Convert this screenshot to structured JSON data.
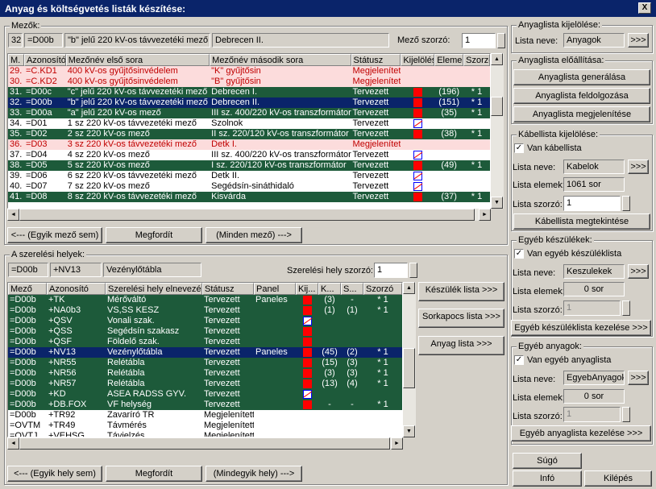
{
  "window": {
    "title": "Anyag és költségvetés listák készítése:",
    "close": "X"
  },
  "fields": {
    "label": "Mezők:",
    "num": "32",
    "code": "=D00b",
    "name1": "\"b\" jelű 220 kV-os távvezetéki mező",
    "name2": "Debrecen II.",
    "multiplier_label": "Mező szorzó:",
    "multiplier": "1",
    "headers": [
      "M.",
      "Azonosító",
      "Mezőnév első sora",
      "Mezőnév második sora",
      "Státusz",
      "Kijelölés",
      "Elemek",
      "Szorzó"
    ],
    "rows": [
      {
        "s": "pink",
        "m": "29.",
        "id": "=C.KD1",
        "n1": "400 kV-os gyűjtősinvédelem",
        "n2": "\"K\" gyűjtősin",
        "st": "Megjelenített",
        "k": "",
        "e": "",
        "sz": ""
      },
      {
        "s": "pink",
        "m": "30.",
        "id": "=C.KD2",
        "n1": "400 kV-os gyűjtősinvédelem",
        "n2": "\"B\" gyűjtősin",
        "st": "Megjelenített",
        "k": "",
        "e": "",
        "sz": ""
      },
      {
        "s": "green",
        "m": "31.",
        "id": "=D00c",
        "n1": "\"c\" jelű 220 kV-os távvezetéki mező",
        "n2": "Debrecen I.",
        "st": "Tervezett",
        "k": "red",
        "e": "(196)",
        "sz": "* 1"
      },
      {
        "s": "sel",
        "m": "32.",
        "id": "=D00b",
        "n1": "\"b\" jelű 220 kV-os távvezetéki mező",
        "n2": "Debrecen II.",
        "st": "Tervezett",
        "k": "red",
        "e": "(151)",
        "sz": "* 1"
      },
      {
        "s": "green",
        "m": "33.",
        "id": "=D00a",
        "n1": "\"a\" jelű 220 kV-os mező",
        "n2": "III sz. 400/220 kV-os transzformátor",
        "st": "Tervezett",
        "k": "red",
        "e": "(35)",
        "sz": "* 1"
      },
      {
        "s": "wh",
        "m": "34.",
        "id": "=D01",
        "n1": "1 sz 220 kV-os távvezetéki mező",
        "n2": "Szolnok",
        "st": "Tervezett",
        "k": "x",
        "e": "",
        "sz": ""
      },
      {
        "s": "green",
        "m": "35.",
        "id": "=D02",
        "n1": "2 sz 220 kV-os mező",
        "n2": "II sz. 220/120 kV-os transzformátor",
        "st": "Tervezett",
        "k": "red",
        "e": "(38)",
        "sz": "* 1"
      },
      {
        "s": "pink",
        "m": "36.",
        "id": "=D03",
        "n1": "3 sz 220 kV-os távvezetéki mező",
        "n2": "Detk I.",
        "st": "Megjelenített",
        "k": "",
        "e": "",
        "sz": ""
      },
      {
        "s": "wh",
        "m": "37.",
        "id": "=D04",
        "n1": "4 sz 220 kV-os mező",
        "n2": "III sz. 400/220 kV-os transzformátor",
        "st": "Tervezett",
        "k": "x",
        "e": "",
        "sz": ""
      },
      {
        "s": "green",
        "m": "38.",
        "id": "=D05",
        "n1": "5 sz 220 kV-os mező",
        "n2": "I sz. 220/120 kV-os transzformátor",
        "st": "Tervezett",
        "k": "red",
        "e": "(49)",
        "sz": "* 1"
      },
      {
        "s": "wh",
        "m": "39.",
        "id": "=D06",
        "n1": "6 sz 220 kV-os távvezetéki mező",
        "n2": "Detk II.",
        "st": "Tervezett",
        "k": "x",
        "e": "",
        "sz": ""
      },
      {
        "s": "wh",
        "m": "40.",
        "id": "=D07",
        "n1": "7 sz 220 kV-os mező",
        "n2": "Segédsín-sináthidaló",
        "st": "Tervezett",
        "k": "x",
        "e": "",
        "sz": ""
      },
      {
        "s": "green",
        "m": "41.",
        "id": "=D08",
        "n1": "8 sz 220 kV-os távvezetéki mező",
        "n2": "Kisvárda",
        "st": "Tervezett",
        "k": "red",
        "e": "(37)",
        "sz": "* 1"
      }
    ],
    "btn_none": "<--- (Egyik mező sem)",
    "btn_reverse": "Megfordít",
    "btn_all": "(Minden mező) --->"
  },
  "places": {
    "label": "A szerelési helyek:",
    "code": "=D00b",
    "loc": "+NV13",
    "name": "Vezénylőtábla",
    "multiplier_label": "Szerelési hely szorzó:",
    "multiplier": "1",
    "headers": [
      "Mező",
      "Azonosító",
      "Szerelési hely elnevezés",
      "Státusz",
      "Panel",
      "Kij...",
      "K...",
      "S...",
      "Szorzó"
    ],
    "rows": [
      {
        "s": "green",
        "m": "=D00b",
        "id": "+TK",
        "n": "Mérőváltó",
        "st": "Tervezett",
        "p": "Paneles",
        "k": "red",
        "a": "(3)",
        "b": "-",
        "sz": "* 1"
      },
      {
        "s": "green",
        "m": "=D00b",
        "id": "+NA0b3",
        "n": "VS,SS KESZ",
        "st": "Tervezett",
        "p": "",
        "k": "red",
        "a": "(1)",
        "b": "(1)",
        "sz": "* 1"
      },
      {
        "s": "green",
        "m": "=D00b",
        "id": "+QSV",
        "n": "Vonali szak.",
        "st": "Tervezett",
        "p": "",
        "k": "x",
        "a": "",
        "b": "",
        "sz": ""
      },
      {
        "s": "green",
        "m": "=D00b",
        "id": "+QSS",
        "n": "Segédsín szakasz",
        "st": "Tervezett",
        "p": "",
        "k": "red",
        "a": "",
        "b": "",
        "sz": ""
      },
      {
        "s": "green",
        "m": "=D00b",
        "id": "+QSF",
        "n": "Földelő szak.",
        "st": "Tervezett",
        "p": "",
        "k": "red",
        "a": "",
        "b": "",
        "sz": ""
      },
      {
        "s": "sel",
        "m": "=D00b",
        "id": "+NV13",
        "n": "Vezénylőtábla",
        "st": "Tervezett",
        "p": "Paneles",
        "k": "red",
        "a": "(45)",
        "b": "(2)",
        "sz": "* 1"
      },
      {
        "s": "green",
        "m": "=D00b",
        "id": "+NR55",
        "n": "Relétábla",
        "st": "Tervezett",
        "p": "",
        "k": "red",
        "a": "(15)",
        "b": "(3)",
        "sz": "* 1"
      },
      {
        "s": "green",
        "m": "=D00b",
        "id": "+NR56",
        "n": "Relétábla",
        "st": "Tervezett",
        "p": "",
        "k": "red",
        "a": "(3)",
        "b": "(3)",
        "sz": "* 1"
      },
      {
        "s": "green",
        "m": "=D00b",
        "id": "+NR57",
        "n": "Relétábla",
        "st": "Tervezett",
        "p": "",
        "k": "red",
        "a": "(13)",
        "b": "(4)",
        "sz": "* 1"
      },
      {
        "s": "green",
        "m": "=D00b",
        "id": "+KD",
        "n": "ASEA RADSS GYV.",
        "st": "Tervezett",
        "p": "",
        "k": "x",
        "a": "",
        "b": "",
        "sz": ""
      },
      {
        "s": "green",
        "m": "=D00b",
        "id": "+DB.FOX",
        "n": "VF helység",
        "st": "Tervezett",
        "p": "",
        "k": "red",
        "a": "-",
        "b": "-",
        "sz": "* 1"
      },
      {
        "s": "wh",
        "m": "=D00b",
        "id": "+TR92",
        "n": "Zavaríró TR",
        "st": "Megjelenített",
        "p": "",
        "k": "",
        "a": "",
        "b": "",
        "sz": ""
      },
      {
        "s": "wh",
        "m": "=OVTM",
        "id": "+TR49",
        "n": "Távmérés",
        "st": "Megjelenített",
        "p": "",
        "k": "",
        "a": "",
        "b": "",
        "sz": ""
      },
      {
        "s": "wh",
        "m": "=OVTJ",
        "id": "+VEHSG",
        "n": "Távjelzés",
        "st": "Megjelenített",
        "p": "",
        "k": "",
        "a": "",
        "b": "",
        "sz": ""
      }
    ],
    "btn_dev": "Készülék lista >>>",
    "btn_term": "Sorkapocs lista >>>",
    "btn_mat": "Anyag lista >>>",
    "btn_none": "<--- (Egyik hely sem)",
    "btn_reverse": "Megfordít",
    "btn_all": "(Mindegyik hely) --->"
  },
  "right": {
    "sel_label": "Anyaglista kijelölése:",
    "list_name_label": "Lista neve:",
    "list_name": "Anyagok",
    "more": ">>>",
    "prod_label": "Anyaglista előállítása:",
    "gen": "Anyaglista generálása",
    "proc": "Anyaglista feldolgozása",
    "show": "Anyaglista megjelenítése",
    "cable_label": "Kábellista kijelölése:",
    "cable_chk": "Van kábellista",
    "cable_name": "Kabelok",
    "elems_label": "Lista elemek:",
    "cable_elems": "1061 sor",
    "mult_label": "Lista szorzó:",
    "cable_mult": "1",
    "cable_view": "Kábellista megtekintése",
    "dev_label": "Egyéb készülékek:",
    "dev_chk": "Van egyéb készüléklista",
    "dev_name": "Keszulekek",
    "dev_elems": "0 sor",
    "dev_mult": "1",
    "dev_manage": "Egyéb készüléklista kezelése >>>",
    "mat_label": "Egyéb anyagok:",
    "mat_chk": "Van egyéb anyaglista",
    "mat_name": "EgyebAnyagok",
    "mat_elems": "0 sor",
    "mat_mult": "1",
    "mat_manage": "Egyéb anyaglista kezelése >>>",
    "help": "Súgó",
    "info": "Infó",
    "exit": "Kilépés",
    "check": "✓"
  }
}
